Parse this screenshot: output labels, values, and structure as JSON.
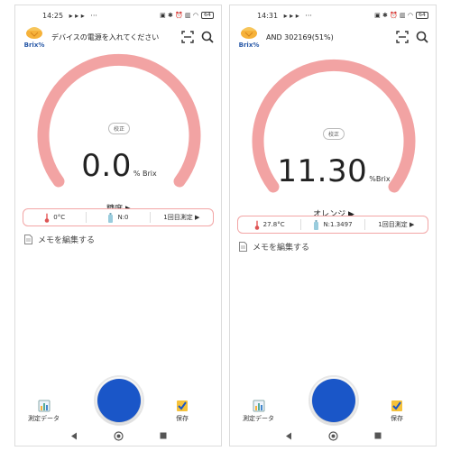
{
  "screens": [
    {
      "status": {
        "time": "14:25",
        "play_icons": "▸ ▸ ▸",
        "more": "···",
        "battery": "64"
      },
      "appbar": {
        "logo_text": "Brix%",
        "title": "デバイスの電源を入れてください"
      },
      "gauge": {
        "calibrate_label": "校正",
        "value": "0.0",
        "unit": "% Brix",
        "mode_label": "糖度 ▶",
        "fill_fraction": 0.0
      },
      "info": {
        "temperature": "0°C",
        "count": "N:0",
        "measure_label": "1回目測定 ▶"
      },
      "memo_label": "メモを編集する",
      "bottom": {
        "data_label": "測定データ",
        "save_label": "保存"
      }
    },
    {
      "status": {
        "time": "14:31",
        "play_icons": "▸ ▸ ▸",
        "more": "···",
        "battery": "64"
      },
      "appbar": {
        "logo_text": "Brix%",
        "title": "AND 302169(51%)"
      },
      "gauge": {
        "calibrate_label": "校正",
        "value": "11.30",
        "unit": "%Brix",
        "mode_label": "オレンジ ▶",
        "fill_fraction": 0.0
      },
      "info": {
        "temperature": "27.8°C",
        "count": "N:1.3497",
        "measure_label": "1回目測定 ▶"
      },
      "memo_label": "メモを編集する",
      "bottom": {
        "data_label": "測定データ",
        "save_label": "保存"
      }
    }
  ],
  "colors": {
    "arc": "#f2a3a3",
    "accent": "#1a56c8",
    "info_border": "#f2a5a5"
  },
  "icons": {
    "scan": "scan-icon",
    "search": "search-icon",
    "thermometer": "thermometer-icon",
    "bottle": "bottle-icon",
    "memo": "document-icon",
    "data": "chart-icon",
    "save": "save-icon",
    "back": "back-icon",
    "home": "home-icon",
    "recents": "recents-icon"
  }
}
